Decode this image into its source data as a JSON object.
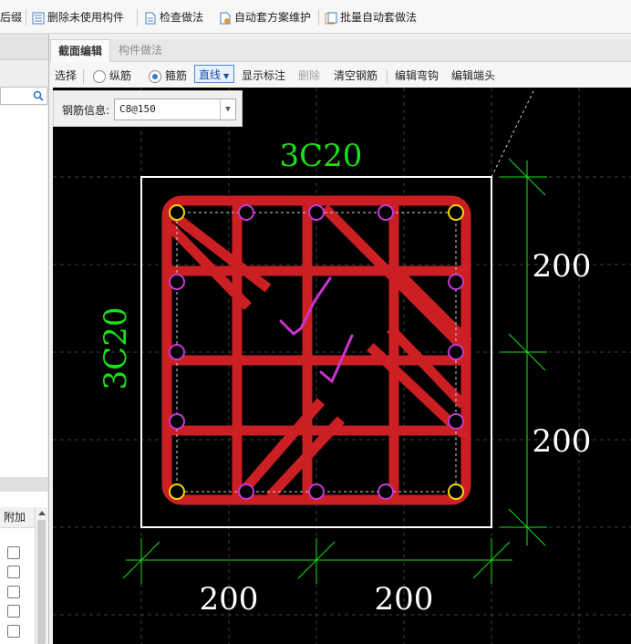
{
  "toolbar": {
    "items": [
      "后缀",
      "删除未使用构件",
      "检查做法",
      "自动套方案维护",
      "批量自动套做法"
    ]
  },
  "tabs": [
    "截面编辑",
    "构件做法"
  ],
  "section_toolbar": {
    "select": "选择",
    "radio_longitudinal": "纵筋",
    "radio_stirrup": "箍筋",
    "line_mode": "直线",
    "show_labels": "显示标注",
    "delete": "删除",
    "clear_rebar": "清空钢筋",
    "edit_hook": "编辑弯钩",
    "edit_end": "编辑端头"
  },
  "rebar_info": {
    "label": "钢筋信息:",
    "value": "C8@150"
  },
  "left_panel": {
    "table_header": "附加"
  },
  "drawing": {
    "top_label": "3C20",
    "side_label": "3C20",
    "dim_right_upper": "200",
    "dim_right_lower": "200",
    "dim_bottom_left": "200",
    "dim_bottom_right": "200",
    "colors": {
      "rebar": "#cc1f24",
      "annotation": "#19e019",
      "section_outline": "#ffffff",
      "bar_corner": "#f0d800",
      "bar_middle": "#c43ad4",
      "handwriting": "#cc33cc"
    }
  }
}
